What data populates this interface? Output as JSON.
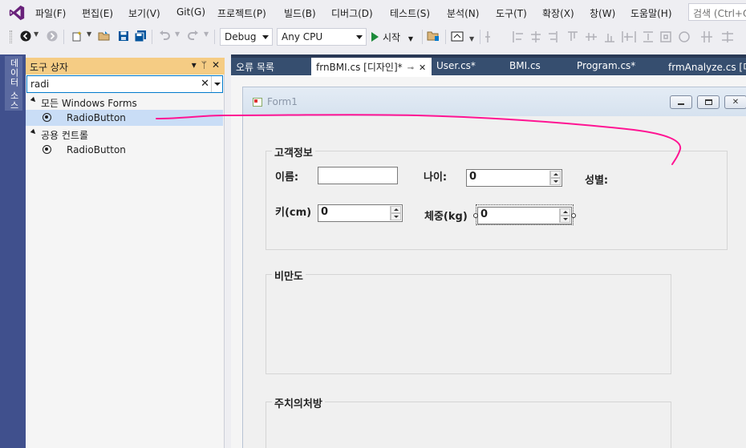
{
  "menu": [
    "파일(F)",
    "편집(E)",
    "보기(V)",
    "Git(G)",
    "프로젝트(P)",
    "빌드(B)",
    "디버그(D)",
    "테스트(S)",
    "분석(N)",
    "도구(T)",
    "확장(X)",
    "창(W)",
    "도움말(H)"
  ],
  "search": {
    "placeholder": "검색 (Ctrl+Q)"
  },
  "toolbar": {
    "config": "Debug",
    "platform": "Any CPU",
    "start_label": "시작"
  },
  "side_tab": {
    "label": "데이터 소스"
  },
  "toolbox": {
    "title": "도구 상자",
    "pin_glyph": "ᛘ",
    "close_glyph": "✕",
    "dropdown_glyph": "▾",
    "search_value": "radi",
    "categories": [
      {
        "label": "모든 Windows Forms",
        "items": [
          "RadioButton"
        ]
      },
      {
        "label": "공용 컨트롤",
        "items": [
          "RadioButton"
        ]
      }
    ]
  },
  "tabs": [
    {
      "label": "오류 목록"
    },
    {
      "label": "frnBMI.cs [디자인]*",
      "active": true
    },
    {
      "label": "User.cs*"
    },
    {
      "label": "BMI.cs"
    },
    {
      "label": "Program.cs*"
    },
    {
      "label": "frmAnalyze.cs [디자인]"
    }
  ],
  "form": {
    "title": "Form1",
    "groups": {
      "customer": "고객정보",
      "obesity": "비만도",
      "prescription": "주치의처방"
    },
    "labels": {
      "name": "이름:",
      "age": "나이:",
      "gender": "성별:",
      "height": "키(cm)",
      "weight": "체중(kg)"
    },
    "values": {
      "name": "",
      "age": "0",
      "height": "0",
      "weight": "0"
    }
  },
  "colors": {
    "accent": "#007acc",
    "toolbox_title": "#f5cc84",
    "tabbar": "#293955",
    "selection": "#c9ddf6",
    "annotation": "#ff1493"
  }
}
